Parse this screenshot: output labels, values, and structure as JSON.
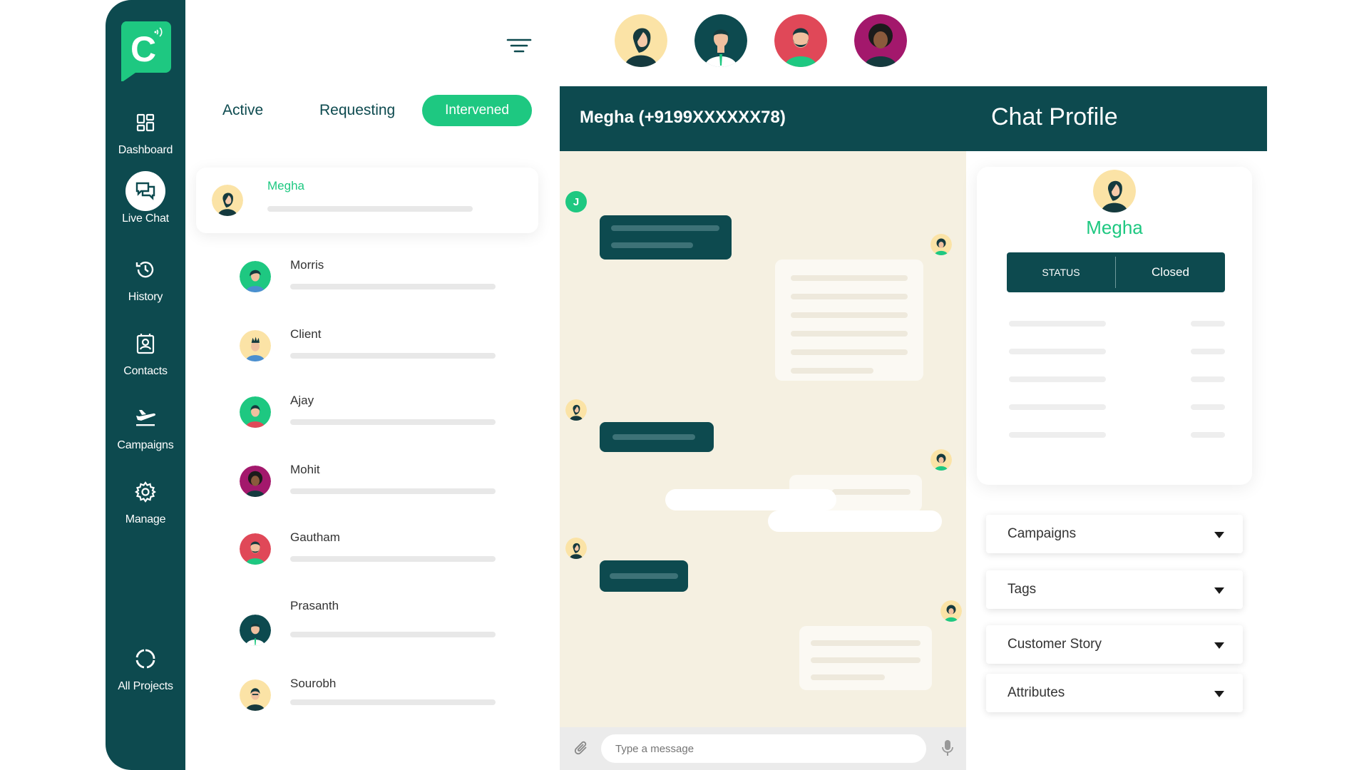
{
  "sidebar": {
    "logo_letter": "C",
    "items": [
      {
        "label": "Dashboard",
        "icon": "dashboard-icon"
      },
      {
        "label": "Live Chat",
        "icon": "chat-icon"
      },
      {
        "label": "History",
        "icon": "history-icon"
      },
      {
        "label": "Contacts",
        "icon": "contacts-icon"
      },
      {
        "label": "Campaigns",
        "icon": "airplane-icon"
      },
      {
        "label": "Manage",
        "icon": "gear-icon"
      }
    ],
    "footer": {
      "label": "All Projects",
      "icon": "circle-progress-icon"
    }
  },
  "tabs": {
    "active": "Active",
    "requesting": "Requesting",
    "intervened": "Intervened"
  },
  "contacts": [
    "Megha",
    "Morris",
    "Client",
    "Ajay",
    "Mohit",
    "Gautham",
    "Prasanth",
    "Sourobh"
  ],
  "chat": {
    "title": "Megha (+9199XXXXXX78)",
    "agent_initial": "J",
    "input_placeholder": "Type a message"
  },
  "profile": {
    "title": "Chat Profile",
    "name": "Megha",
    "status_label": "STATUS",
    "status_value": "Closed"
  },
  "dropdowns": [
    "Campaigns",
    "Tags",
    "Customer Story",
    "Attributes"
  ],
  "colors": {
    "primary": "#0d4a4f",
    "accent": "#1ec881",
    "chat_bg": "#f5f0e1"
  }
}
